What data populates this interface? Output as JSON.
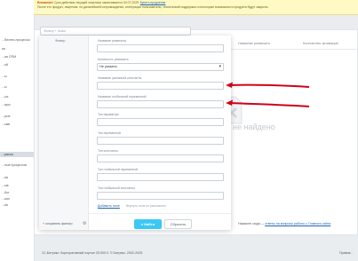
{
  "banner": {
    "lead": "Внимание!",
    "text1": " Срок действия текущей лицензии заканчивается 04.07.2025.",
    "link": "Купить продление",
    "text2": "После его продукт, лицензия, по дальнейшей сопровождения, интеграции пользователи, технический поддержки и некоторые возможности продукта будут закрыты."
  },
  "sidebar": {
    "items": [
      {
        "label": "...бизнес-процессы",
        "active": false
      },
      {
        "label": "ия",
        "active": false
      },
      {
        "label": "...ия CRM",
        "active": false
      },
      {
        "label": "...ей",
        "active": false
      },
      {
        "label": "...ы",
        "active": false
      },
      {
        "label": "...ы",
        "active": false
      },
      {
        "label": "...ых",
        "active": false
      },
      {
        "label": "...иры",
        "active": false
      },
      {
        "label": "...рые",
        "active": false
      },
      {
        "label": "...ыкв",
        "active": false
      },
      {
        "label": "...расса",
        "active": true
      },
      {
        "label": "...ные процессов",
        "active": false
      },
      {
        "label": "...яв",
        "active": false
      },
      {
        "label": "...ыв",
        "active": false
      },
      {
        "label": "...бот",
        "active": false
      },
      {
        "label": "...кая",
        "active": false
      },
      {
        "label": "...ия",
        "active": false
      }
    ]
  },
  "search": {
    "placeholder": "Фильтр + поиск"
  },
  "columns": {
    "name": "Название реквизита",
    "count": "Количество активаций"
  },
  "empty": {
    "text": "не найдено"
  },
  "filter": {
    "presets_header": "Фильтр",
    "save_filter": "+ сохранить фильтр",
    "fields": [
      {
        "label": "Название реквизита",
        "value": "",
        "type": "input"
      },
      {
        "label": "Активность реквизита",
        "value": "Не указано",
        "type": "select"
      },
      {
        "label": "Название указанной константы",
        "value": "",
        "type": "input"
      },
      {
        "label": "Название глобальной переменной",
        "value": "",
        "type": "input"
      },
      {
        "label": "Тип параметра",
        "value": "",
        "type": "input"
      },
      {
        "label": "Тип переменной",
        "value": "",
        "type": "input"
      },
      {
        "label": "Тип константы",
        "value": "",
        "type": "input"
      },
      {
        "label": "Тип глобальной переменной",
        "value": "",
        "type": "input"
      },
      {
        "label": "Тип глобальной константы",
        "value": "",
        "type": "input"
      }
    ],
    "add_field": "Добавить поле",
    "restore": "Вернуть поля по умолчанию",
    "find_button": "Найти",
    "reset_button": "Сбросить"
  },
  "bottom_note": {
    "prefix": "Нажмите сюда — ",
    "link": "ответы на вопросы работы с Главного сайта"
  },
  "footer": {
    "copyright": "1С-Битрикс: Корпоративный портал 25.500.0. © Битрикс, 2002-2025.",
    "right": "Правов..."
  },
  "colors": {
    "accent": "#3bc8f5",
    "arrow": "#d0021b",
    "banner": "#fff9c4"
  }
}
